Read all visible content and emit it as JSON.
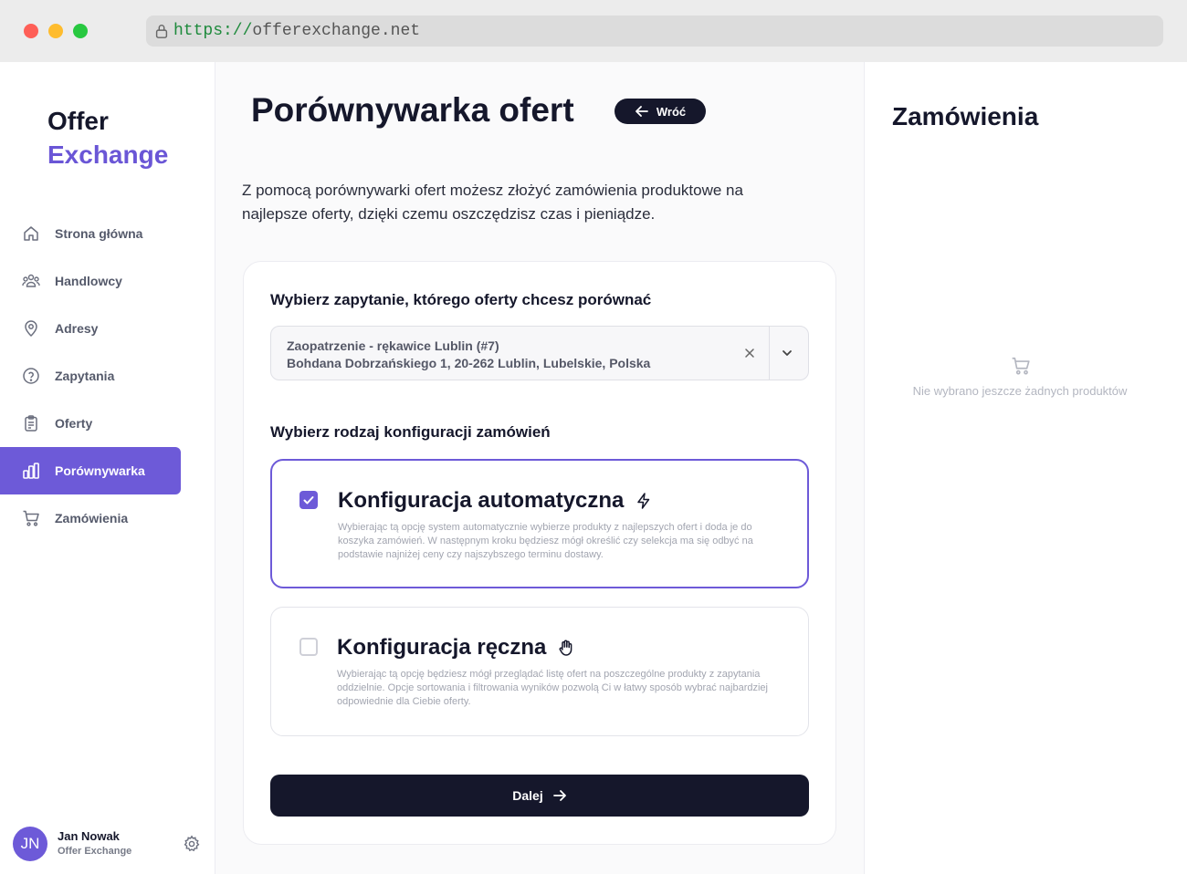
{
  "browser": {
    "url_scheme": "https://",
    "url_host": "offerexchange.net"
  },
  "sidebar": {
    "logo_line1": "Offer",
    "logo_line2": "Exchange",
    "items": [
      {
        "label": "Strona główna",
        "icon": "home-icon"
      },
      {
        "label": "Handlowcy",
        "icon": "users-icon"
      },
      {
        "label": "Adresy",
        "icon": "map-pin-icon"
      },
      {
        "label": "Zapytania",
        "icon": "question-icon"
      },
      {
        "label": "Oferty",
        "icon": "clipboard-icon"
      },
      {
        "label": "Porównywarka",
        "icon": "bar-chart-icon",
        "active": true
      },
      {
        "label": "Zamówienia",
        "icon": "cart-icon"
      }
    ],
    "user": {
      "initials": "JN",
      "name": "Jan Nowak",
      "org": "Offer Exchange"
    }
  },
  "main": {
    "title": "Porównywarka ofert",
    "back_label": "Wróć",
    "intro": "Z pomocą porównywarki ofert możesz złożyć zamówienia produktowe na najlepsze oferty, dzięki czemu oszczędzisz czas i pieniądze.",
    "select_heading": "Wybierz zapytanie, którego oferty chcesz porównać",
    "select_value_line1": "Zaopatrzenie - rękawice Lublin (#7)",
    "select_value_line2": "Bohdana Dobrzańskiego 1, 20-262 Lublin, Lubelskie, Polska",
    "config_heading": "Wybierz rodzaj konfiguracji zamówień",
    "options": [
      {
        "title": "Konfiguracja automatyczna",
        "icon": "lightning-icon",
        "checked": true,
        "description": "Wybierając tą opcję system automatycznie wybierze produkty z najlepszych ofert i doda je do koszyka zamówień. W następnym kroku będziesz mógł określić czy selekcja ma się odbyć na podstawie najniżej ceny czy najszybszego terminu dostawy."
      },
      {
        "title": "Konfiguracja ręczna",
        "icon": "hand-icon",
        "checked": false,
        "description": "Wybierając tą opcję będziesz mógł przeglądać listę ofert na poszczególne produkty z zapytania oddzielnie. Opcje sortowania i filtrowania wyników pozwolą Ci w łatwy sposób wybrać najbardziej odpowiednie dla Ciebie oferty."
      }
    ],
    "next_label": "Dalej"
  },
  "orders": {
    "title": "Zamówienia",
    "empty_text": "Nie wybrano jeszcze żadnych produktów"
  },
  "colors": {
    "accent": "#6d5ad8",
    "dark": "#15172b"
  }
}
